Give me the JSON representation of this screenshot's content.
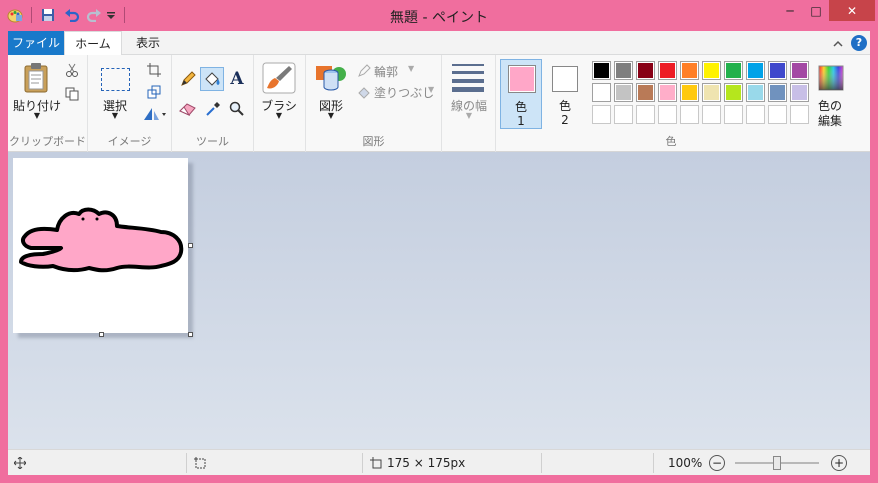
{
  "window": {
    "title": "無題 - ペイント",
    "frame_color": "#f06e9e"
  },
  "quick_access": {
    "icons": [
      "paint-app-icon",
      "save-icon",
      "undo-icon",
      "redo-icon",
      "customize-dropdown-icon"
    ]
  },
  "window_controls": {
    "minimize": "─",
    "maximize": "□",
    "close": "✕"
  },
  "tabs": {
    "file": "ファイル",
    "home": "ホーム",
    "view": "表示"
  },
  "ribbon_right": {
    "collapse": "^",
    "help": "?"
  },
  "clipboard": {
    "paste": "貼り付け",
    "group": "クリップボード"
  },
  "image": {
    "select": "選択",
    "group": "イメージ"
  },
  "tools": {
    "group": "ツール",
    "text_glyph": "A"
  },
  "brushes": {
    "label": "ブラシ"
  },
  "shapes": {
    "shapes_label": "図形",
    "outline": "輪郭",
    "fill": "塗りつぶし",
    "group": "図形"
  },
  "size": {
    "label": "線の幅"
  },
  "colors": {
    "color1_label": "色",
    "color1_num": "1",
    "color1_value": "#ffa7c8",
    "color2_label": "色",
    "color2_num": "2",
    "color2_value": "#ffffff",
    "edit_label_1": "色の",
    "edit_label_2": "編集",
    "group": "色",
    "palette_row1": [
      "#000000",
      "#7f7f7f",
      "#880015",
      "#ed1c24",
      "#ff7f27",
      "#fff200",
      "#22b14c",
      "#00a2e8",
      "#3f48cc",
      "#a349a4"
    ],
    "palette_row2": [
      "#ffffff",
      "#c3c3c3",
      "#b97a57",
      "#ffaec9",
      "#ffc90e",
      "#efe4b0",
      "#b5e61d",
      "#99d9ea",
      "#7092be",
      "#c8bfe7"
    ],
    "palette_row3": [
      "#ffffff",
      "#ffffff",
      "#ffffff",
      "#ffffff",
      "#ffffff",
      "#ffffff",
      "#ffffff",
      "#ffffff",
      "#ffffff",
      "#ffffff"
    ]
  },
  "status": {
    "canvas_size": "175 × 175px",
    "zoom": "100%",
    "zoom_level": 1.0,
    "zoom_out": "−",
    "zoom_in": "+"
  }
}
